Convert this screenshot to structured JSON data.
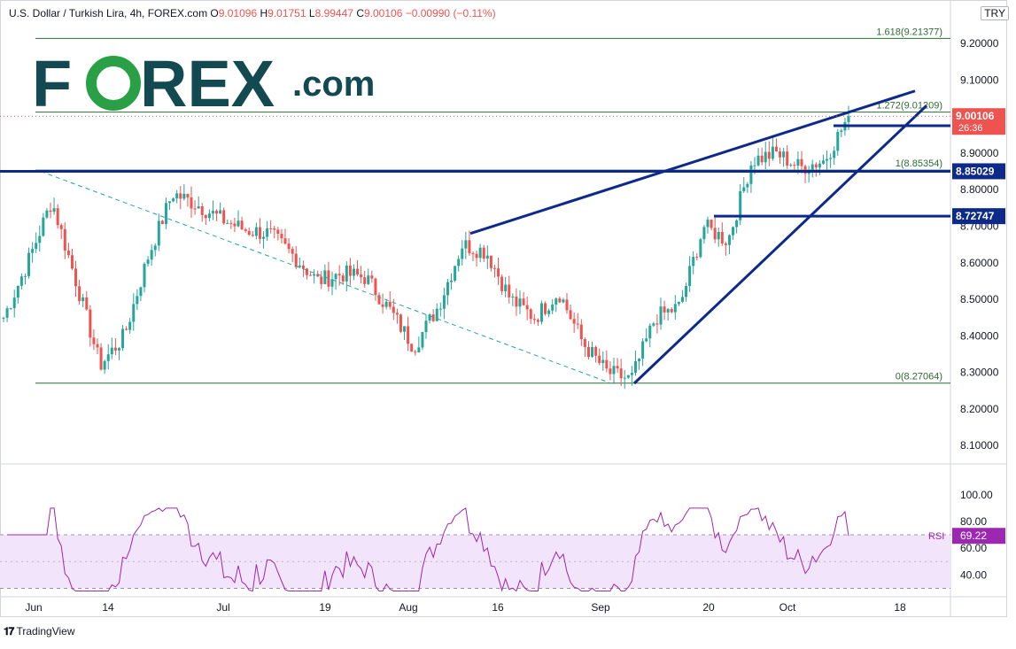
{
  "header": {
    "symbol": "U.S. Dollar / Turkish Lira, 4h, FOREX.com",
    "open_label": "O",
    "open": "9.01096",
    "high_label": "H",
    "high": "9.01751",
    "low_label": "L",
    "low": "8.99447",
    "close_label": "C",
    "close": "9.00106",
    "change": "−0.00990 (−0.11%)"
  },
  "currency_badge": "TRY",
  "logo_text": {
    "main": "F•REX",
    "suffix": ".com"
  },
  "footer_brand": "TradingView",
  "colors": {
    "up": "#26a69a",
    "down": "#ef5350",
    "drawing": "#0d2a8a",
    "fib": "#2e6b34",
    "rsi": "#9c27b0",
    "rsi_band": "#f1e4fb",
    "logo_dark": "#134a52",
    "logo_green": "#2aa046",
    "price_tag": "#ef5350"
  },
  "chart_data": {
    "type": "candlestick",
    "x_ticks": [
      "Jun",
      "14",
      "Jul",
      "19",
      "Aug",
      "16",
      "Sep",
      "20",
      "Oct",
      "18"
    ],
    "y_ticks": [
      "9.20000",
      "9.10000",
      "9.00000",
      "8.90000",
      "8.80000",
      "8.70000",
      "8.60000",
      "8.50000",
      "8.40000",
      "8.30000",
      "8.20000",
      "8.10000"
    ],
    "y_range": [
      8.05,
      9.27
    ],
    "last_price": "9.00106",
    "countdown": "26:36",
    "horizontal_levels": [
      "8.97486",
      "8.85029",
      "8.72747"
    ],
    "fibonacci": [
      {
        "label": "1.618(9.21377)",
        "value": 9.21377
      },
      {
        "label": "1.272(9.01209)",
        "value": 9.01209
      },
      {
        "label": "1(8.85354)",
        "value": 8.85354
      },
      {
        "label": "0(8.27064)",
        "value": 8.27064
      }
    ],
    "anchors": [
      [
        "Jun",
        8.45
      ],
      [
        "Jun",
        8.6
      ],
      [
        "Jun",
        8.77
      ],
      [
        "14",
        8.55
      ],
      [
        "14",
        8.32
      ],
      [
        "14",
        8.4
      ],
      [
        "14",
        8.62
      ],
      [
        "14",
        8.79
      ],
      [
        "Jul",
        8.76
      ],
      [
        "Jul",
        8.72
      ],
      [
        "Jul",
        8.69
      ],
      [
        "Jul",
        8.68
      ],
      [
        "19",
        8.62
      ],
      [
        "19",
        8.55
      ],
      [
        "19",
        8.57
      ],
      [
        "19",
        8.56
      ],
      [
        "Aug",
        8.47
      ],
      [
        "Aug",
        8.37
      ],
      [
        "Aug",
        8.48
      ],
      [
        "Aug",
        8.65
      ],
      [
        "16",
        8.63
      ],
      [
        "16",
        8.5
      ],
      [
        "16",
        8.45
      ],
      [
        "16",
        8.52
      ],
      [
        "Sep",
        8.38
      ],
      [
        "Sep",
        8.3
      ],
      [
        "Sep",
        8.28
      ],
      [
        "Sep",
        8.45
      ],
      [
        "20",
        8.48
      ],
      [
        "20",
        8.7
      ],
      [
        "20",
        8.66
      ],
      [
        "20",
        8.88
      ],
      [
        "Oct",
        8.9
      ],
      [
        "Oct",
        8.86
      ],
      [
        "Oct",
        8.88
      ],
      [
        "Oct",
        9.0
      ]
    ],
    "rsi": {
      "label": "RSI",
      "value": "69.22",
      "y_ticks": [
        "100.00",
        "80.00",
        "60.00",
        "40.00"
      ],
      "y_range": [
        25,
        105
      ],
      "band": [
        30,
        70
      ]
    }
  }
}
